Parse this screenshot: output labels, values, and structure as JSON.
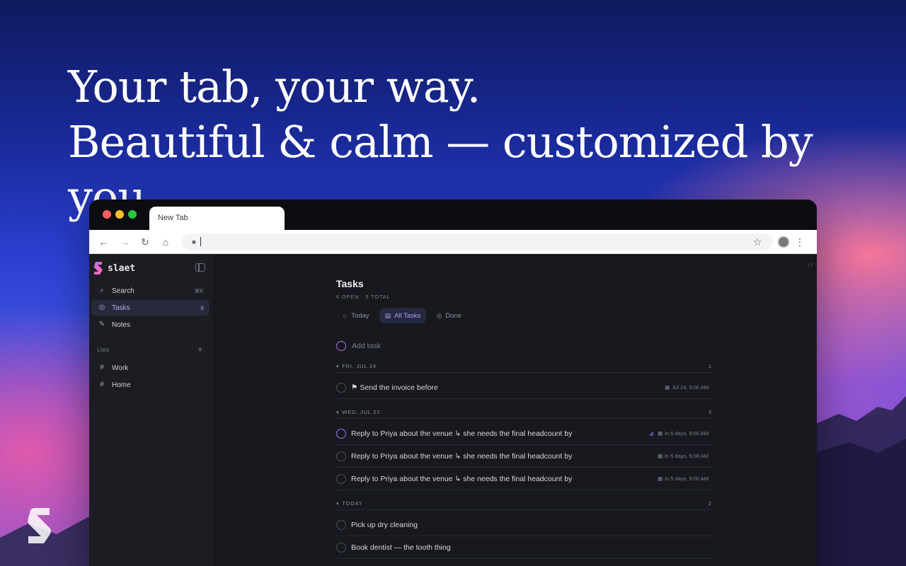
{
  "headline": {
    "line1": "Your tab, your way.",
    "line2": "Beautiful & calm — customized by you."
  },
  "browser": {
    "tab_title": "New Tab",
    "icons": {
      "back": "arrow-left-icon",
      "forward": "arrow-right-icon",
      "reload": "reload-icon",
      "home": "home-icon",
      "lock": "lock-icon",
      "star": "star-icon",
      "menu": "kebab-menu-icon"
    }
  },
  "sidebar": {
    "app_name": "slaet",
    "nav": [
      {
        "label": "Search",
        "icon": "search-icon",
        "shortcut": "⌘K"
      },
      {
        "label": "Tasks",
        "icon": "check-circle-icon",
        "count": "6",
        "active": true
      },
      {
        "label": "Notes",
        "icon": "edit-icon"
      }
    ],
    "lists_header": "Lists",
    "lists": [
      {
        "label": "Work",
        "icon": "hash-icon"
      },
      {
        "label": "Home",
        "icon": "hash-icon"
      }
    ]
  },
  "main": {
    "title": "Tasks",
    "subtitle": "6 OPEN · 6 TOTAL",
    "filters": [
      {
        "label": "Today",
        "icon": "sun-icon"
      },
      {
        "label": "All Tasks",
        "icon": "clipboard-icon",
        "active": true
      },
      {
        "label": "Done",
        "icon": "check-circle-icon"
      }
    ],
    "add_task_placeholder": "Add task",
    "groups": [
      {
        "label": "FRI, JUL 24",
        "count": "1",
        "tasks": [
          {
            "text": "⚑ Send the invoice before",
            "meta": "Jul 24, 9:00 AM"
          }
        ]
      },
      {
        "label": "WED, JUL 22",
        "count": "3",
        "tasks": [
          {
            "text": "Reply to Priya about the venue ↳ she needs the final headcount by",
            "meta": "in 5 days, 9:00 AM",
            "priority": true
          },
          {
            "text": "Reply to Priya about the venue ↳ she needs the final headcount by",
            "meta": "in 5 days, 9:00 AM"
          },
          {
            "text": "Reply to Priya about the venue ↳ she needs the final headcount by",
            "meta": "in 5 days, 9:00 AM"
          }
        ]
      },
      {
        "label": "TODAY",
        "count": "2",
        "tasks": [
          {
            "text": "Pick up dry cleaning"
          },
          {
            "text": "Book dentist — the tooth thing"
          }
        ]
      }
    ]
  },
  "colors": {
    "accent": "#a99cf5",
    "app_bg": "#17191f",
    "sidebar_bg": "#1b1d23"
  }
}
